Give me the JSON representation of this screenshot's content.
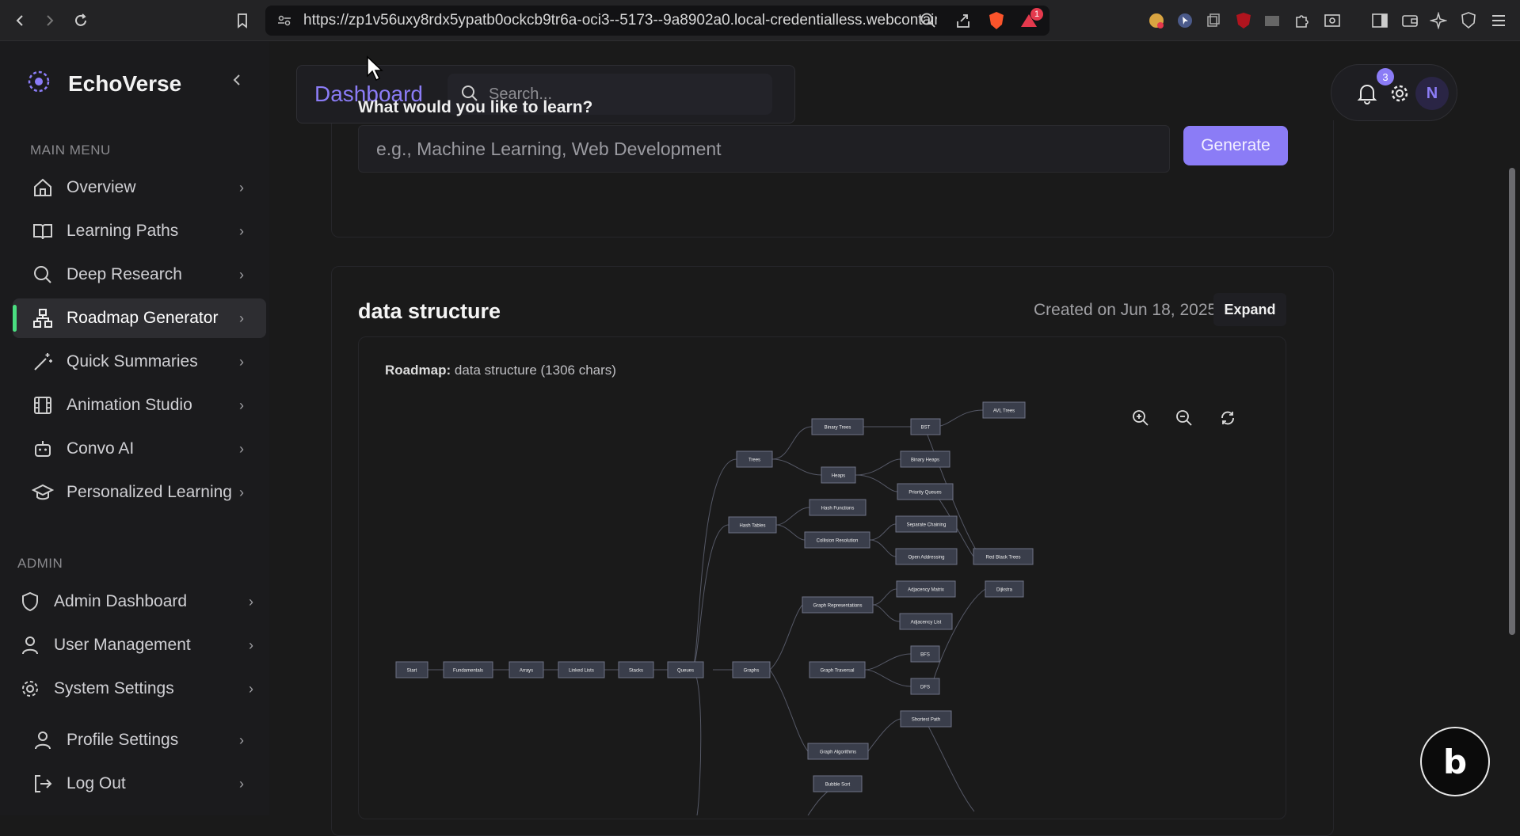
{
  "browser": {
    "url": "https://zp1v56uxy8rdx5ypatb0ockcb9tr6a-oci3--5173--9a8902a0.local-credentialless.webcontain...",
    "notification_count": "1"
  },
  "sidebar": {
    "brand": "EchoVerse",
    "main_menu_label": "MAIN MENU",
    "items": [
      {
        "label": "Overview",
        "icon": "home-icon"
      },
      {
        "label": "Learning Paths",
        "icon": "book-open-icon"
      },
      {
        "label": "Deep Research",
        "icon": "search-icon"
      },
      {
        "label": "Roadmap Generator",
        "icon": "network-icon",
        "active": true
      },
      {
        "label": "Quick Summaries",
        "icon": "magic-wand-icon"
      },
      {
        "label": "Animation Studio",
        "icon": "film-icon"
      },
      {
        "label": "Convo AI",
        "icon": "bot-icon"
      },
      {
        "label": "Personalized Learning",
        "icon": "graduation-cap-icon"
      }
    ],
    "admin_label": "ADMIN",
    "admin_items": [
      {
        "label": "Admin Dashboard",
        "icon": "shield-icon"
      },
      {
        "label": "User Management",
        "icon": "user-icon"
      },
      {
        "label": "System Settings",
        "icon": "gear-icon"
      }
    ],
    "footer_items": [
      {
        "label": "Profile Settings",
        "icon": "user-icon"
      },
      {
        "label": "Log Out",
        "icon": "logout-icon"
      }
    ]
  },
  "header": {
    "title": "Dashboard",
    "search_placeholder": "Search...",
    "notifications_badge": "3",
    "avatar_initial": "N"
  },
  "learn": {
    "label": "What would you like to learn?",
    "placeholder": "e.g., Machine Learning, Web Development",
    "generate_label": "Generate"
  },
  "roadmap": {
    "title": "data structure",
    "created": "Created on Jun 18, 2025",
    "expand_label": "Expand",
    "meta_prefix": "Roadmap:",
    "meta_text": "data structure (1306 chars)",
    "nodes": {
      "start": "Start",
      "fund": "Fundamentals",
      "arrays": "Arrays",
      "ll": "Linked Lists",
      "stacks": "Stacks",
      "queues": "Queues",
      "graphs": "Graphs",
      "trees": "Trees",
      "bt": "Binary Trees",
      "bst": "BST",
      "avl": "AVL Trees",
      "heaps": "Heaps",
      "bheaps": "Binary Heaps",
      "pq": "Priority Queues",
      "ht": "Hash Tables",
      "hf": "Hash Functions",
      "cr": "Collision Resolution",
      "sc": "Separate Chaining",
      "oa": "Open Addressing",
      "rbt": "Red Black Trees",
      "gr": "Graph Representations",
      "am": "Adjacency Matrix",
      "al": "Adjacency List",
      "dij": "Dijkstra",
      "gt": "Graph Traversal",
      "bfs": "BFS",
      "dfs": "DFS",
      "sp": "Shortest Path",
      "ga": "Graph Algorithms",
      "bs": "Bubble Sort"
    }
  },
  "colors": {
    "accent": "#8b7cf6",
    "active_indicator": "#4ade80"
  }
}
